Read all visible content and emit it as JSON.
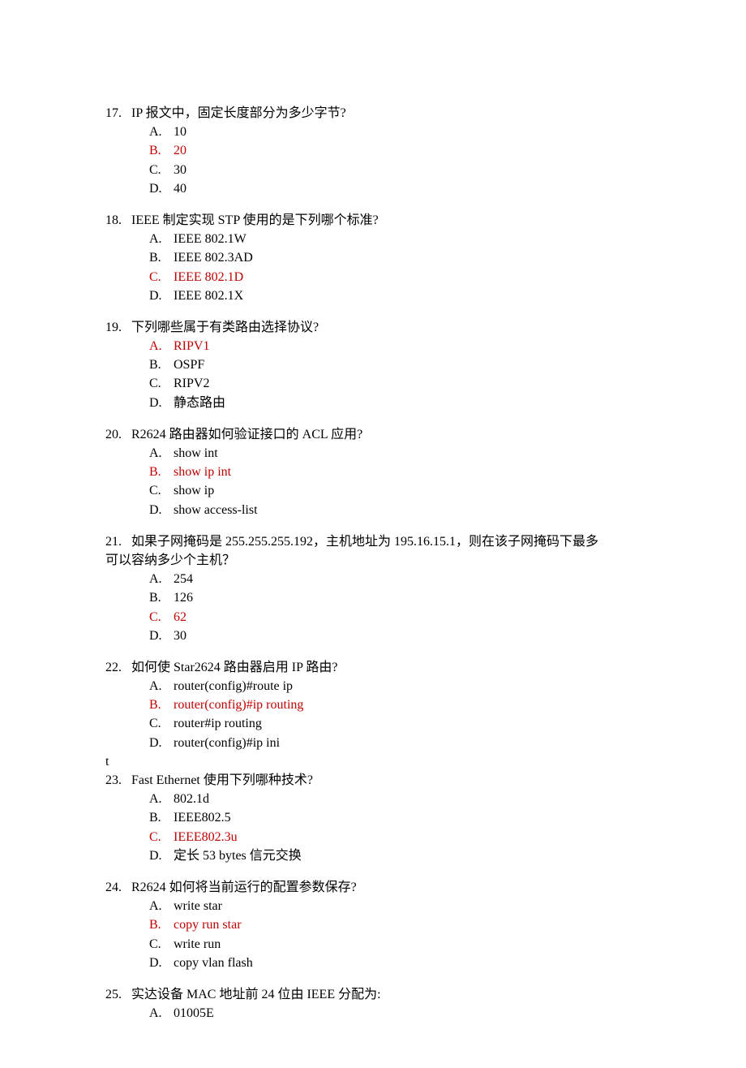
{
  "q17": {
    "number": "17.",
    "text": "IP 报文中，固定长度部分为多少字节?",
    "options": {
      "A": "10",
      "B": "20",
      "C": "30",
      "D": "40"
    },
    "answer": "B"
  },
  "q18": {
    "number": "18.",
    "text": "IEEE 制定实现 STP 使用的是下列哪个标准?",
    "options": {
      "A": "IEEE 802.1W",
      "B": "IEEE 802.3AD",
      "C": "IEEE 802.1D",
      "D": "IEEE 802.1X"
    },
    "answer": "C"
  },
  "q19": {
    "number": "19.",
    "text": "下列哪些属于有类路由选择协议?",
    "options": {
      "A": "RIPV1",
      "B": "OSPF",
      "C": "RIPV2",
      "D": "静态路由"
    },
    "answer": "A"
  },
  "q20": {
    "number": "20.",
    "text": "R2624 路由器如何验证接口的 ACL 应用?",
    "options": {
      "A": "show int",
      "B": "show ip int",
      "C": "show ip",
      "D": "show access-list"
    },
    "answer": "B"
  },
  "q21": {
    "number": "21.",
    "text_line1": "如果子网掩码是 255.255.255.192，主机地址为 195.16.15.1，则在该子网掩码下最多",
    "text_line2": "可以容纳多少个主机？",
    "options": {
      "A": "254",
      "B": "126",
      "C": "62",
      "D": "30"
    },
    "answer": "C"
  },
  "q22": {
    "number": "22.",
    "text": "如何使 Star2624 路由器启用 IP 路由?",
    "options": {
      "A": "router(config)#route ip",
      "B": "router(config)#ip routing",
      "C": "router#ip routing",
      "D": "router(config)#ip ini"
    },
    "answer": "B",
    "stray": "t"
  },
  "q23": {
    "number": "23.",
    "text": "Fast Ethernet 使用下列哪种技术?",
    "options": {
      "A": "802.1d",
      "B": "IEEE802.5",
      "C": "IEEE802.3u",
      "D": "定长 53 bytes 信元交换"
    },
    "answer": "C"
  },
  "q24": {
    "number": "24.",
    "text": "R2624 如何将当前运行的配置参数保存?",
    "options": {
      "A": "write star",
      "B": "copy run star",
      "C": "write run",
      "D": "copy vlan flash"
    },
    "answer": "B"
  },
  "q25": {
    "number": "25.",
    "text": "实达设备 MAC 地址前 24 位由 IEEE 分配为:",
    "options": {
      "A": "01005E"
    },
    "answer": ""
  }
}
